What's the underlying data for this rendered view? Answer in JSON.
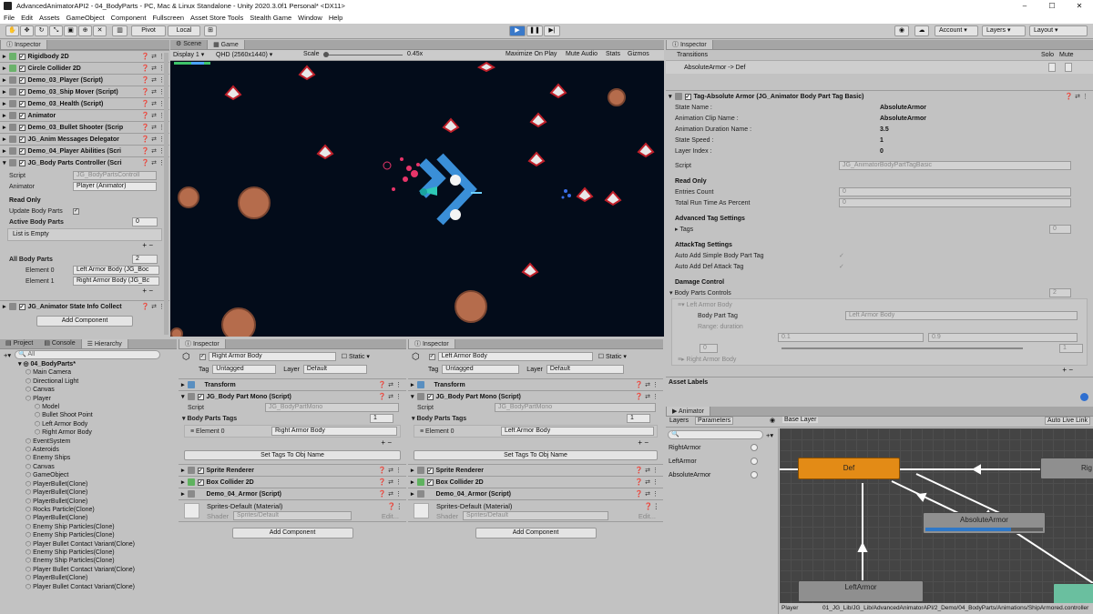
{
  "titlebar": {
    "title": "AdvancedAnimatorAPI2 - 04_BodyParts - PC, Mac & Linux Standalone - Unity 2020.3.0f1 Personal* <DX11>",
    "minimize": "–",
    "maximize": "☐",
    "close": "✕"
  },
  "menu": [
    "File",
    "Edit",
    "Assets",
    "GameObject",
    "Component",
    "Fullscreen",
    "Asset Store Tools",
    "Stealth Game",
    "Window",
    "Help"
  ],
  "toolbar": {
    "pivot": "Pivot",
    "local": "Local",
    "account": "Account",
    "layers": "Layers",
    "layout": "Layout"
  },
  "left_inspector": {
    "tab": "Inspector",
    "components": [
      "Rigidbody 2D",
      "Circle Collider 2D",
      "Demo_03_Player (Script)",
      "Demo_03_Ship Mover (Script)",
      "Demo_03_Health (Script)",
      "Animator",
      "Demo_03_Bullet Shooter (Scrip",
      "JG_Anim Messages Delegator",
      "Demo_04_Player Abilities (Scri",
      "JG_Body Parts Controller (Scri"
    ],
    "script_label": "Script",
    "script_value": "JG_BodyPartsControll",
    "animator_label": "Animator",
    "animator_value": "Player (Animator)",
    "read_only": "Read Only",
    "update_label": "Update Body Parts",
    "active_label": "Active Body Parts",
    "active_count": "0",
    "list_empty": "List is Empty",
    "all_label": "All Body Parts",
    "all_count": "2",
    "el0_label": "Element 0",
    "el0_value": "Left Armor Body (JG_Boc",
    "el1_label": "Element 1",
    "el1_value": "Right Armor Body (JG_Bc",
    "state_info": "JG_Animator State Info Collect",
    "add_component": "Add Component"
  },
  "scene": {
    "tab_scene": "Scene",
    "tab_game": "Game",
    "display": "Display 1",
    "resolution": "QHD (2560x1440)",
    "scale_label": "Scale",
    "scale_value": "0.45x",
    "maximize": "Maximize On Play",
    "mute": "Mute Audio",
    "stats": "Stats",
    "gizmos": "Gizmos"
  },
  "hierarchy": {
    "tabs": [
      "Project",
      "Console",
      "Hierarchy"
    ],
    "search": "All",
    "root": "04_BodyParts*",
    "items": [
      {
        "n": "Main Camera",
        "d": 1
      },
      {
        "n": "Directional Light",
        "d": 1
      },
      {
        "n": "Canvas",
        "d": 1
      },
      {
        "n": "Player",
        "d": 1
      },
      {
        "n": "Model",
        "d": 2
      },
      {
        "n": "Bullet Shoot Point",
        "d": 2
      },
      {
        "n": "Left Armor Body",
        "d": 2
      },
      {
        "n": "Right Armor Body",
        "d": 2
      },
      {
        "n": "EventSystem",
        "d": 1
      },
      {
        "n": "Asteroids",
        "d": 1
      },
      {
        "n": "Enemy Ships",
        "d": 1
      },
      {
        "n": "Canvas",
        "d": 1
      },
      {
        "n": "GameObject",
        "d": 1
      },
      {
        "n": "PlayerBullet(Clone)",
        "d": 1
      },
      {
        "n": "PlayerBullet(Clone)",
        "d": 1
      },
      {
        "n": "PlayerBullet(Clone)",
        "d": 1
      },
      {
        "n": "Rocks Particle(Clone)",
        "d": 1
      },
      {
        "n": "PlayerBullet(Clone)",
        "d": 1
      },
      {
        "n": "Enemy Ship Particles(Clone)",
        "d": 1
      },
      {
        "n": "Enemy Ship Particles(Clone)",
        "d": 1
      },
      {
        "n": "Player Bullet Contact Variant(Clone)",
        "d": 1
      },
      {
        "n": "Enemy Ship Particles(Clone)",
        "d": 1
      },
      {
        "n": "Enemy Ship Particles(Clone)",
        "d": 1
      },
      {
        "n": "Player Bullet Contact Variant(Clone)",
        "d": 1
      },
      {
        "n": "PlayerBullet(Clone)",
        "d": 1
      },
      {
        "n": "Player Bullet Contact Variant(Clone)",
        "d": 1
      }
    ]
  },
  "insp_right_armor": {
    "tab": "Inspector",
    "name": "Right Armor Body",
    "static": "Static",
    "tag_label": "Tag",
    "tag": "Untagged",
    "layer_label": "Layer",
    "layer": "Default",
    "transform": "Transform",
    "mono": "JG_Body Part Mono (Script)",
    "script_label": "Script",
    "script_value": "JG_BodyPartMono",
    "tags_label": "Body Parts Tags",
    "tags_count": "1",
    "el_label": "Element 0",
    "el_value": "Right Armor Body",
    "set_tags": "Set Tags To Obj Name",
    "sprite": "Sprite Renderer",
    "box": "Box Collider 2D",
    "armor": "Demo_04_Armor (Script)",
    "material": "Sprites-Default (Material)",
    "shader_label": "Shader",
    "shader": "Sprites/Default",
    "edit": "Edit...",
    "add_component": "Add Component"
  },
  "insp_left_armor": {
    "tab": "Inspector",
    "name": "Left Armor Body",
    "static": "Static",
    "tag_label": "Tag",
    "tag": "Untagged",
    "layer_label": "Layer",
    "layer": "Default",
    "transform": "Transform",
    "mono": "JG_Body Part Mono (Script)",
    "script_label": "Script",
    "script_value": "JG_BodyPartMono",
    "tags_label": "Body Parts Tags",
    "tags_count": "1",
    "el_label": "Element 0",
    "el_value": "Left Armor Body",
    "set_tags": "Set Tags To Obj Name",
    "sprite": "Sprite Renderer",
    "box": "Box Collider 2D",
    "armor": "Demo_04_Armor (Script)",
    "material": "Sprites-Default (Material)",
    "shader_label": "Shader",
    "shader": "Sprites/Default",
    "edit": "Edit...",
    "add_component": "Add Component"
  },
  "right_inspector": {
    "tab": "Inspector",
    "transitions": "Transitions",
    "solo": "Solo",
    "mute": "Mute",
    "transition": "AbsoluteArmor -> Def",
    "tag_header": "Tag-Absolute Armor (JG_Animator Body Part Tag Basic)",
    "props": [
      {
        "k": "State Name :",
        "v": "AbsoluteArmor"
      },
      {
        "k": "Animation Clip Name :",
        "v": "AbsoluteArmor"
      },
      {
        "k": "Animation Duration Name :",
        "v": "3.5"
      },
      {
        "k": "State Speed :",
        "v": "1"
      },
      {
        "k": "Layer Index :",
        "v": "0"
      }
    ],
    "script_label": "Script",
    "script_value": "JG_AnimatorBodyPartTagBasic",
    "read_only": "Read Only",
    "entries_label": "Entries Count",
    "entries_value": "0",
    "total_label": "Total Run Time As Percent",
    "total_value": "0",
    "adv_header": "Advanced Tag Settings",
    "tags_label": "Tags",
    "tags_value": "0",
    "attack_header": "AttackTag Settings",
    "auto_simple": "Auto Add Simple Body Part Tag",
    "auto_def": "Auto Add Def Attack Tag",
    "damage_header": "Damage Control",
    "controls_label": "Body Parts Controls",
    "controls_value": "2",
    "left_body": "Left Armor Body",
    "part_tag_label": "Body Part Tag",
    "part_tag_value": "Left Armor Body",
    "range_label": "Range: duration",
    "range_min": "0.1",
    "range_max": "0.9",
    "range_lo": "0",
    "range_hi": "1",
    "right_body": "Right Armor Body",
    "asset_labels": "Asset Labels"
  },
  "animator": {
    "tab": "Animator",
    "layers_tab": "Layers",
    "params_tab": "Parameters",
    "base_layer": "Base Layer",
    "auto_live": "Auto Live Link",
    "params": [
      "RightArmor",
      "LeftArmor",
      "AbsoluteArmor"
    ],
    "states": {
      "def": "Def",
      "right": "Rig",
      "absolute": "AbsoluteArmor",
      "left": "LeftArmor"
    },
    "absolute_progress": 0.73,
    "footer_left": "Player",
    "footer_path": "01_JG_Lib/JG_Lib/AdvancedAnimatorAPI/2_Demo/04_BodyParts/Animations/ShipArmored.controller"
  }
}
